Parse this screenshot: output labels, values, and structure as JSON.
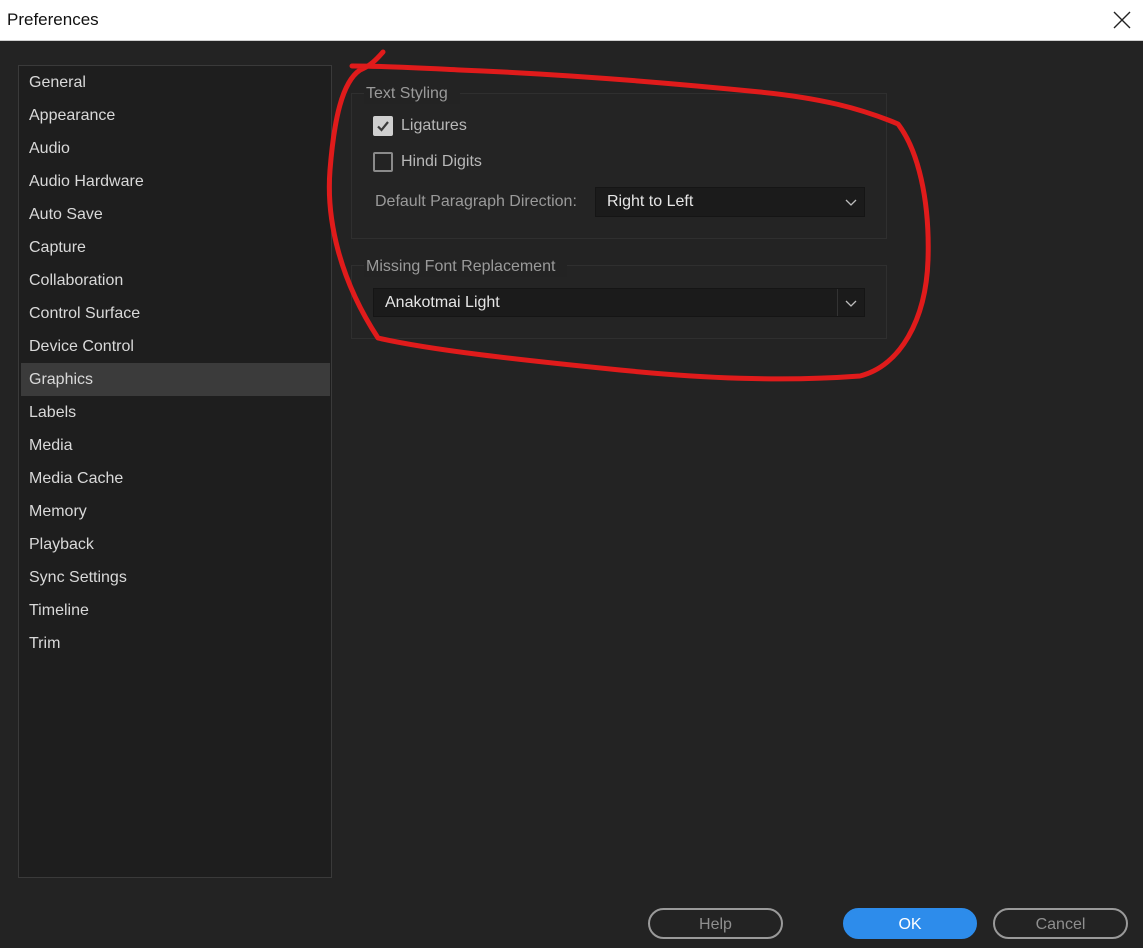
{
  "window": {
    "title": "Preferences"
  },
  "sidebar": {
    "items": [
      {
        "label": "General"
      },
      {
        "label": "Appearance"
      },
      {
        "label": "Audio"
      },
      {
        "label": "Audio Hardware"
      },
      {
        "label": "Auto Save"
      },
      {
        "label": "Capture"
      },
      {
        "label": "Collaboration"
      },
      {
        "label": "Control Surface"
      },
      {
        "label": "Device Control"
      },
      {
        "label": "Graphics",
        "selected": true
      },
      {
        "label": "Labels"
      },
      {
        "label": "Media"
      },
      {
        "label": "Media Cache"
      },
      {
        "label": "Memory"
      },
      {
        "label": "Playback"
      },
      {
        "label": "Sync Settings"
      },
      {
        "label": "Timeline"
      },
      {
        "label": "Trim"
      }
    ]
  },
  "text_styling": {
    "title": "Text Styling",
    "ligatures": {
      "label": "Ligatures",
      "checked": true
    },
    "hindi_digits": {
      "label": "Hindi Digits",
      "checked": false
    },
    "paragraph_direction": {
      "label": "Default Paragraph Direction:",
      "value": "Right to Left"
    }
  },
  "missing_font": {
    "title": "Missing Font Replacement",
    "value": "Anakotmai Light"
  },
  "footer": {
    "help_label": "Help",
    "ok_label": "OK",
    "cancel_label": "Cancel"
  },
  "colors": {
    "background": "#232323",
    "accent": "#2d8ceb",
    "annotation": "#e01b1b"
  },
  "icons": {
    "close": "close-icon",
    "check": "check-icon",
    "chevron": "chevron-down-icon"
  }
}
